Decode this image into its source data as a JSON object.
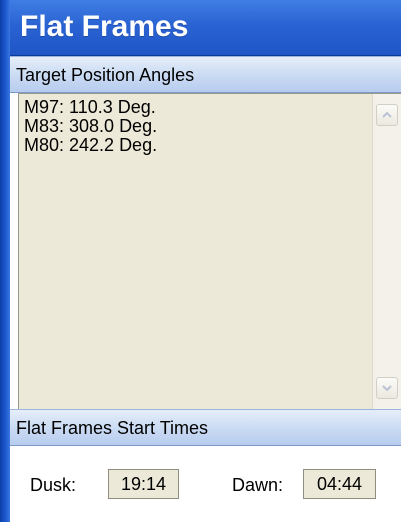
{
  "window": {
    "title": "Flat Frames"
  },
  "angles_section": {
    "header": "Target Position Angles",
    "items": [
      "M97: 110.3 Deg.",
      "M83: 308.0 Deg.",
      "M80: 242.2 Deg."
    ]
  },
  "times_section": {
    "header": "Flat Frames Start Times",
    "dusk_label": "Dusk:",
    "dusk_value": "19:14",
    "dawn_label": "Dawn:",
    "dawn_value": "04:44"
  },
  "icons": {
    "scroll_up": "chevron-up-icon",
    "scroll_down": "chevron-down-icon"
  },
  "colors": {
    "title_bar": "#2a63d3",
    "section_header": "#c9daf3",
    "panel_background": "#ece9d8"
  }
}
